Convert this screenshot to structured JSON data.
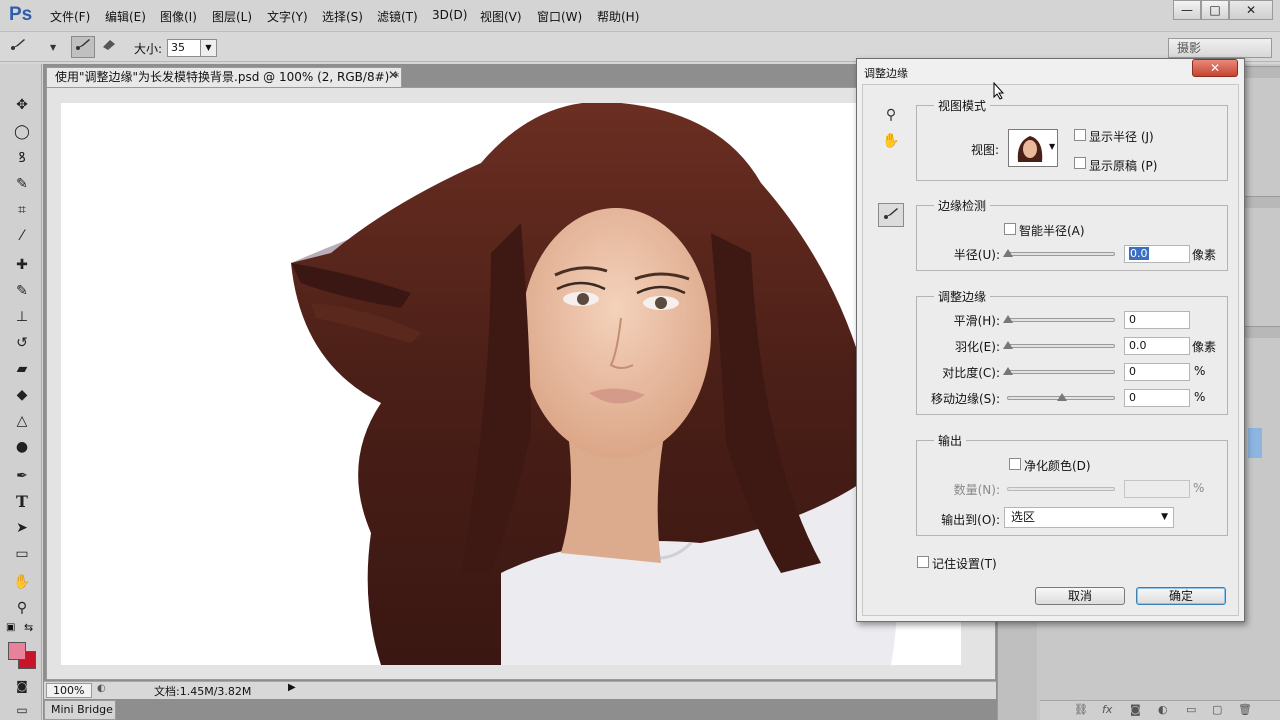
{
  "app": {
    "logo": "Ps",
    "menu": [
      "文件(F)",
      "编辑(E)",
      "图像(I)",
      "图层(L)",
      "文字(Y)",
      "选择(S)",
      "滤镜(T)",
      "3D(D)",
      "视图(V)",
      "窗口(W)",
      "帮助(H)"
    ],
    "window_buttons": {
      "minimize": "—",
      "maximize": "□",
      "close": "✕"
    }
  },
  "options": {
    "size_label": "大小:",
    "size_value": "35",
    "workspace": "摄影"
  },
  "document": {
    "tab_title": "使用\"调整边缘\"为长发模特换背景.psd @ 100% (2, RGB/8#) *",
    "zoom": "100%",
    "doc_size": "文档:1.45M/3.82M"
  },
  "mini_bridge": "Mini Bridge",
  "dialog": {
    "title": "调整边缘",
    "close": "✕",
    "view_mode": {
      "title": "视图模式",
      "view_label": "视图:",
      "show_radius": "显示半径 (J)",
      "show_original": "显示原稿 (P)"
    },
    "edge_detection": {
      "title": "边缘检测",
      "smart_radius": "智能半径(A)",
      "radius_label": "半径(U):",
      "radius_value": "0.0",
      "radius_unit": "像素"
    },
    "adjust_edge": {
      "title": "调整边缘",
      "smooth_label": "平滑(H):",
      "smooth_value": "0",
      "feather_label": "羽化(E):",
      "feather_value": "0.0",
      "feather_unit": "像素",
      "contrast_label": "对比度(C):",
      "contrast_value": "0",
      "contrast_unit": "%",
      "shift_label": "移动边缘(S):",
      "shift_value": "0",
      "shift_unit": "%"
    },
    "output": {
      "title": "输出",
      "decontaminate": "净化颜色(D)",
      "amount_label": "数量(N):",
      "amount_unit": "%",
      "output_to_label": "输出到(O):",
      "output_to_value": "选区"
    },
    "remember": "记住设置(T)",
    "cancel": "取消",
    "ok": "确定"
  },
  "colors": {
    "foreground": "#e8829a",
    "background": "#c8142a",
    "hair": "#4a1f17",
    "skin": "#e9b99b"
  }
}
